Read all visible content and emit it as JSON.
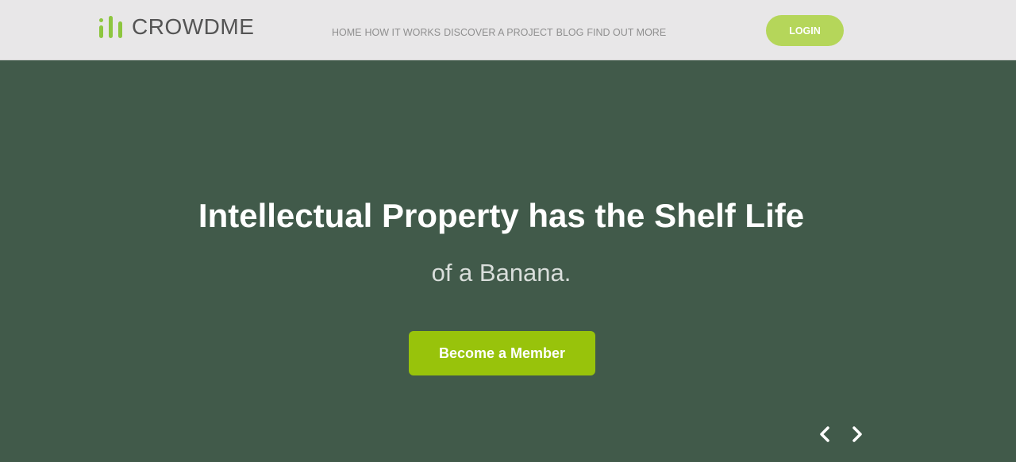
{
  "brand": {
    "name": "CROWDME",
    "accent_color": "#8dc63f",
    "logo_icon": "bar-chart-icon"
  },
  "nav": {
    "items": [
      "HOME",
      "HOW IT WORKS",
      "DISCOVER A PROJECT",
      "BLOG",
      "FIND OUT MORE"
    ]
  },
  "header": {
    "login_label": "LOGIN",
    "login_color": "#b5d65a"
  },
  "hero": {
    "title": "Intellectual Property has the Shelf Life",
    "subtitle": "of a Banana.",
    "cta_label": "Become a Member",
    "cta_color": "#98c30b",
    "background_color": "#415a4a"
  },
  "carousel": {
    "prev_icon": "chevron-left-icon",
    "next_icon": "chevron-right-icon"
  }
}
